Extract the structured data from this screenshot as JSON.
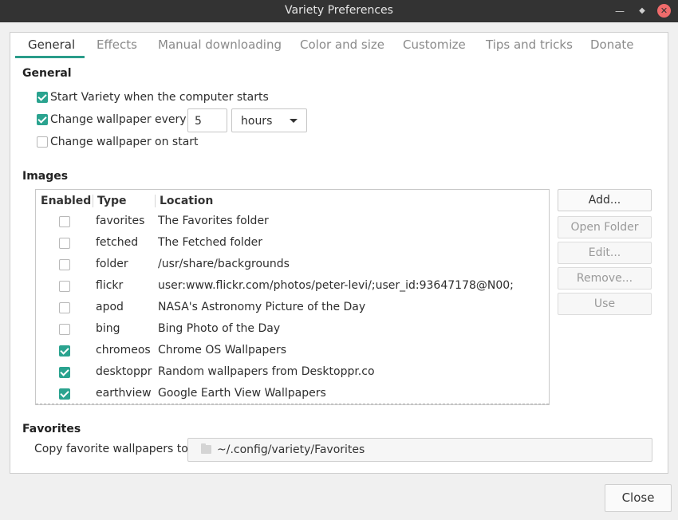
{
  "window": {
    "title": "Variety Preferences"
  },
  "tabs": [
    "General",
    "Effects",
    "Manual downloading",
    "Color and size",
    "Customize",
    "Tips and tricks",
    "Donate"
  ],
  "general": {
    "heading": "General",
    "start_on_boot": {
      "label": "Start Variety when the computer starts",
      "checked": true
    },
    "change_every": {
      "label": "Change wallpaper every",
      "checked": true,
      "value": "5",
      "unit": "hours"
    },
    "change_on_start": {
      "label": "Change wallpaper on start",
      "checked": false
    }
  },
  "images": {
    "heading": "Images",
    "columns": [
      "Enabled",
      "Type",
      "Location"
    ],
    "rows": [
      {
        "enabled": false,
        "type": "favorites",
        "location": "The Favorites folder"
      },
      {
        "enabled": false,
        "type": "fetched",
        "location": "The Fetched folder"
      },
      {
        "enabled": false,
        "type": "folder",
        "location": "/usr/share/backgrounds"
      },
      {
        "enabled": false,
        "type": "flickr",
        "location": "user:www.flickr.com/photos/peter-levi/;user_id:93647178@N00;"
      },
      {
        "enabled": false,
        "type": "apod",
        "location": "NASA's Astronomy Picture of the Day"
      },
      {
        "enabled": false,
        "type": "bing",
        "location": "Bing Photo of the Day"
      },
      {
        "enabled": true,
        "type": "chromeos",
        "location": "Chrome OS Wallpapers"
      },
      {
        "enabled": true,
        "type": "desktoppr",
        "location": "Random wallpapers from Desktoppr.co"
      },
      {
        "enabled": true,
        "type": "earthview",
        "location": "Google Earth View Wallpapers"
      }
    ],
    "buttons": {
      "add": "Add...",
      "open_folder": "Open Folder",
      "edit": "Edit...",
      "remove": "Remove...",
      "use": "Use"
    }
  },
  "favorites": {
    "heading": "Favorites",
    "copy_label": "Copy favorite wallpapers to",
    "path": "~/.config/variety/Favorites"
  },
  "footer": {
    "close": "Close"
  },
  "colors": {
    "accent": "#2aa38f",
    "titlebar": "#333333",
    "close_button": "#f06b6b"
  }
}
